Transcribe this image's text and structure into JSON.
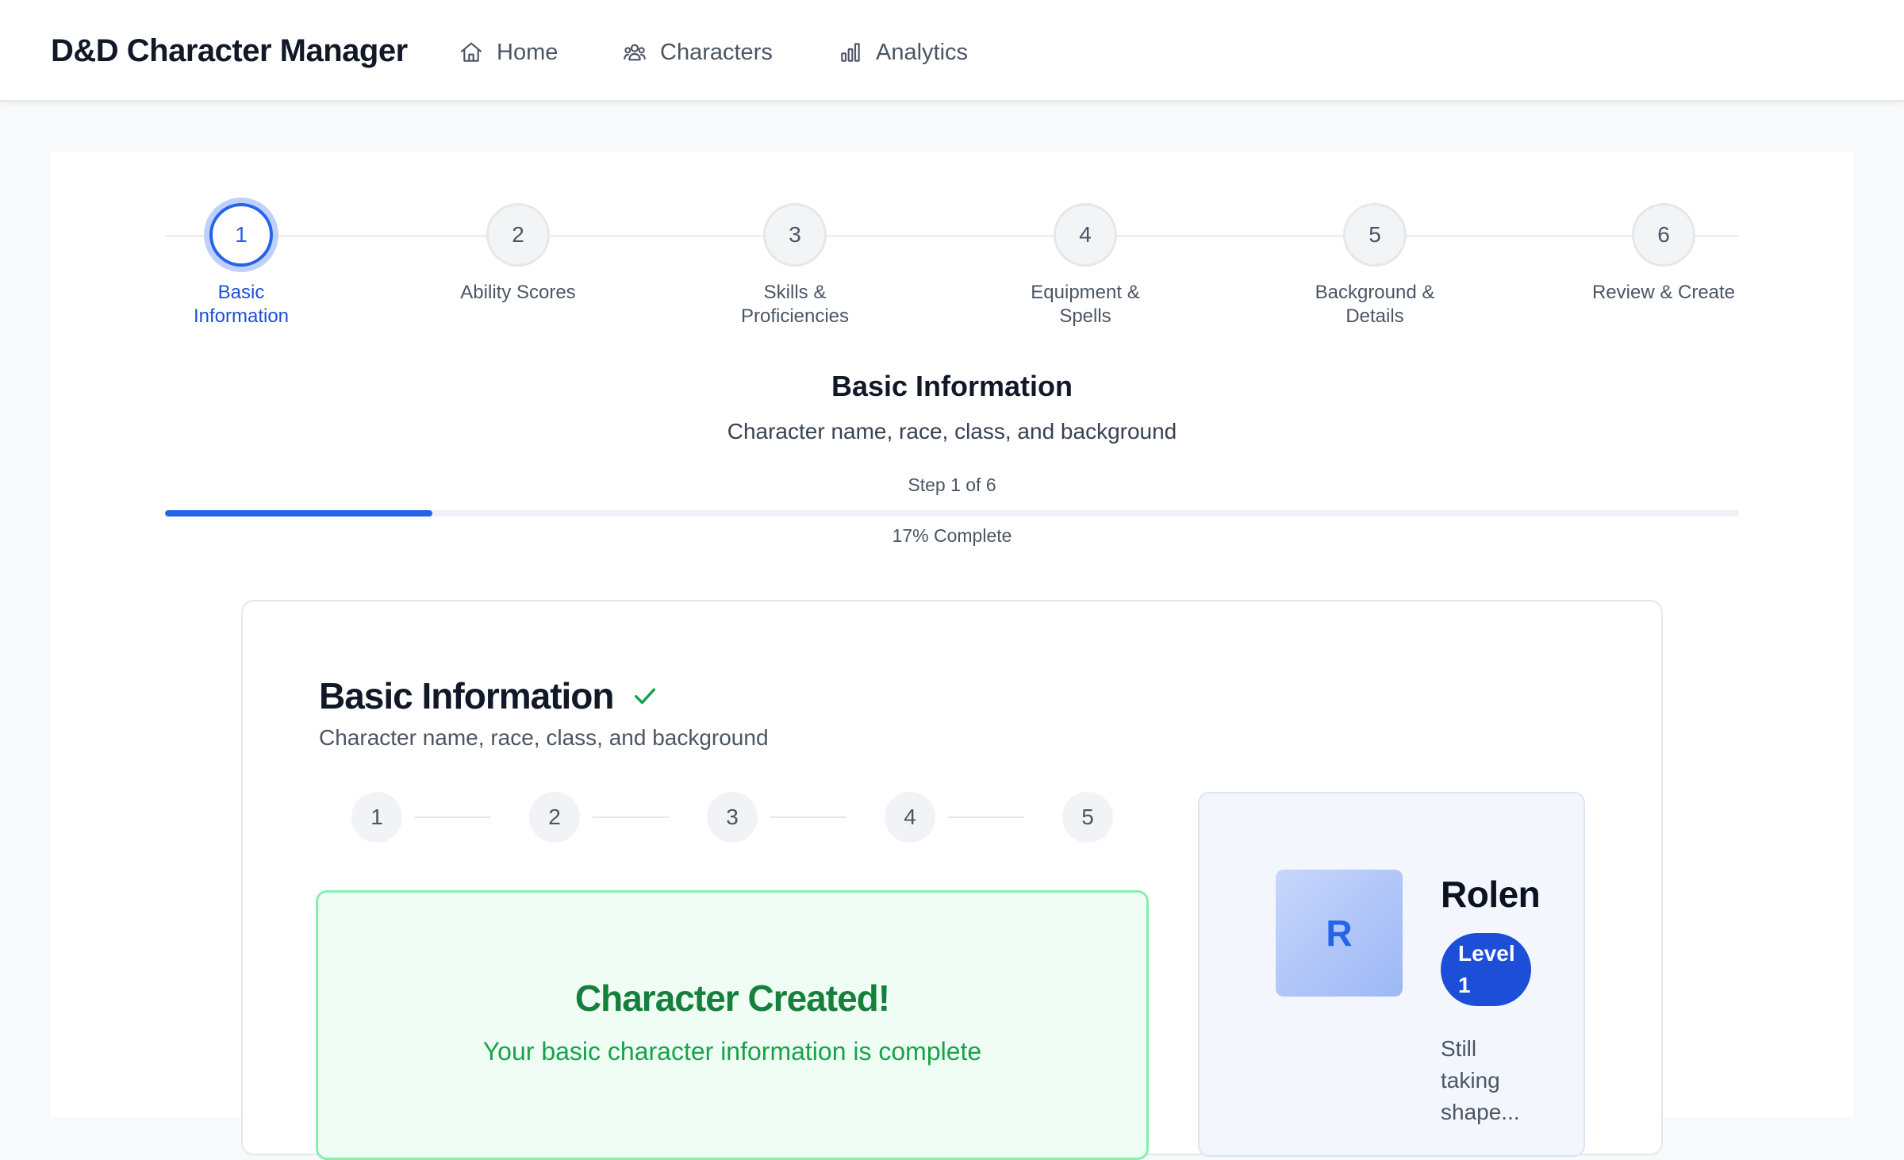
{
  "app": {
    "title": "D&D Character Manager"
  },
  "nav": {
    "items": [
      {
        "label": "Home",
        "icon": "home-icon"
      },
      {
        "label": "Characters",
        "icon": "users-icon"
      },
      {
        "label": "Analytics",
        "icon": "bar-chart-icon"
      }
    ]
  },
  "stepper": {
    "steps": [
      {
        "number": "1",
        "label": "Basic Information"
      },
      {
        "number": "2",
        "label": "Ability Scores"
      },
      {
        "number": "3",
        "label": "Skills & Proficiencies"
      },
      {
        "number": "4",
        "label": "Equipment & Spells"
      },
      {
        "number": "5",
        "label": "Background & Details"
      },
      {
        "number": "6",
        "label": "Review & Create"
      }
    ],
    "active_index": 0
  },
  "section": {
    "title": "Basic Information",
    "subtitle": "Character name, race, class, and background",
    "step_of": "Step 1 of 6",
    "progress_fraction": 0.17,
    "progress_text": "17% Complete"
  },
  "form": {
    "title": "Basic Information",
    "title_icon": "check-icon",
    "subtitle": "Character name, race, class, and background",
    "sub_steps": [
      "1",
      "2",
      "3",
      "4",
      "5"
    ],
    "success": {
      "title": "Character Created!",
      "message": "Your basic character information is complete"
    }
  },
  "preview": {
    "avatar_letter": "R",
    "name": "Rolen",
    "level": "Level 1",
    "note": "Still taking shape..."
  },
  "colors": {
    "accent": "#2563eb",
    "success": "#16a34a",
    "success_bg": "#f0fdf4"
  }
}
